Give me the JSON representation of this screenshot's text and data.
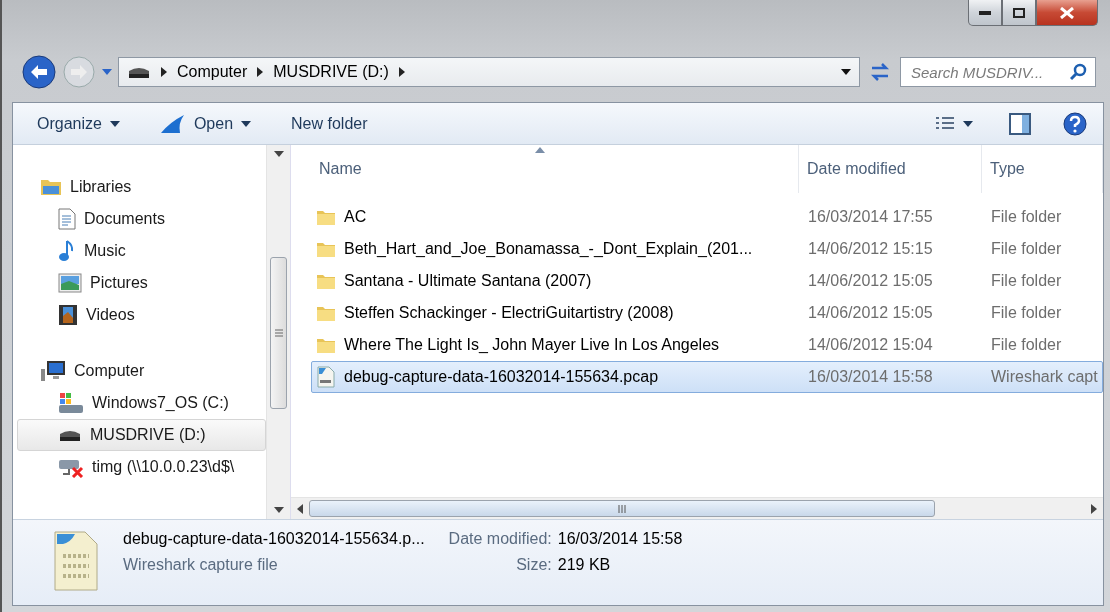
{
  "address": {
    "crumbs": [
      "Computer",
      "MUSDRIVE (D:)"
    ]
  },
  "search": {
    "placeholder": "Search MUSDRIV..."
  },
  "toolbar": {
    "buttons": [
      {
        "label": "Organize",
        "kind": "menu"
      },
      {
        "label": "Open",
        "kind": "open"
      },
      {
        "label": "New folder",
        "kind": "plain"
      }
    ]
  },
  "sidebar": {
    "items": [
      {
        "label": "Libraries",
        "kind": "libraries",
        "selected": false,
        "children": [
          {
            "label": "Documents",
            "kind": "documents",
            "selected": false
          },
          {
            "label": "Music",
            "kind": "music",
            "selected": false
          },
          {
            "label": "Pictures",
            "kind": "pictures",
            "selected": false
          },
          {
            "label": "Videos",
            "kind": "videos",
            "selected": false
          }
        ]
      },
      {
        "label": "Computer",
        "kind": "computer",
        "selected": false,
        "children": [
          {
            "label": "Windows7_OS (C:)",
            "kind": "osdrive",
            "selected": false
          },
          {
            "label": "MUSDRIVE (D:)",
            "kind": "drive",
            "selected": true
          },
          {
            "label": "timg (\\\\10.0.0.23\\d$\\",
            "kind": "netdrive",
            "selected": false
          }
        ]
      }
    ]
  },
  "table": {
    "columns": [
      {
        "label": "Name",
        "sorted": true
      },
      {
        "label": "Date modified",
        "sorted": false
      },
      {
        "label": "Type",
        "sorted": false
      }
    ],
    "rows": [
      {
        "name": "AC",
        "date": "16/03/2014 17:55",
        "type": "File folder",
        "kind": "folder",
        "selected": false
      },
      {
        "name": "Beth_Hart_and_Joe_Bonamassa_-_Dont_Explain_(201...",
        "date": "14/06/2012 15:15",
        "type": "File folder",
        "kind": "folder",
        "selected": false
      },
      {
        "name": "Santana - Ultimate Santana (2007)",
        "date": "14/06/2012 15:05",
        "type": "File folder",
        "kind": "folder",
        "selected": false
      },
      {
        "name": "Steffen Schackinger - ElectriGuitartistry (2008)",
        "date": "14/06/2012 15:05",
        "type": "File folder",
        "kind": "folder",
        "selected": false
      },
      {
        "name": "Where The Light Is_ John Mayer Live In Los Angeles",
        "date": "14/06/2012 15:04",
        "type": "File folder",
        "kind": "folder",
        "selected": false
      },
      {
        "name": "debug-capture-data-16032014-155634.pcap",
        "date": "16/03/2014 15:58",
        "type": "Wireshark capt",
        "kind": "file",
        "selected": true
      }
    ]
  },
  "details": {
    "name": "debug-capture-data-16032014-155634.p...",
    "type": "Wireshark capture file",
    "fields": [
      {
        "label": "Date modified:",
        "value": "16/03/2014 15:58"
      },
      {
        "label": "Size:",
        "value": "219 KB"
      }
    ]
  }
}
